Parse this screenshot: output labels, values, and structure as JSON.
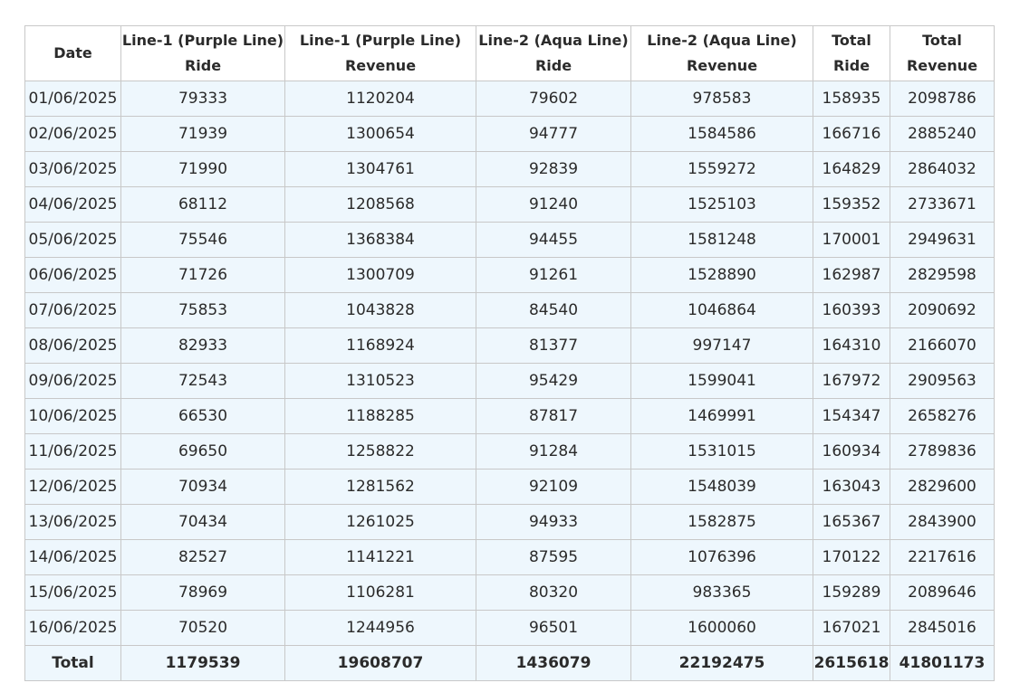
{
  "table": {
    "headers": [
      [
        "Date"
      ],
      [
        "Line-1 (Purple Line)",
        "Ride"
      ],
      [
        "Line-1 (Purple Line)",
        "Revenue"
      ],
      [
        "Line-2 (Aqua Line)",
        "Ride"
      ],
      [
        "Line-2 (Aqua Line)",
        "Revenue"
      ],
      [
        "Total",
        "Ride"
      ],
      [
        "Total",
        "Revenue"
      ]
    ],
    "rows": [
      [
        "01/06/2025",
        "79333",
        "1120204",
        "79602",
        "978583",
        "158935",
        "2098786"
      ],
      [
        "02/06/2025",
        "71939",
        "1300654",
        "94777",
        "1584586",
        "166716",
        "2885240"
      ],
      [
        "03/06/2025",
        "71990",
        "1304761",
        "92839",
        "1559272",
        "164829",
        "2864032"
      ],
      [
        "04/06/2025",
        "68112",
        "1208568",
        "91240",
        "1525103",
        "159352",
        "2733671"
      ],
      [
        "05/06/2025",
        "75546",
        "1368384",
        "94455",
        "1581248",
        "170001",
        "2949631"
      ],
      [
        "06/06/2025",
        "71726",
        "1300709",
        "91261",
        "1528890",
        "162987",
        "2829598"
      ],
      [
        "07/06/2025",
        "75853",
        "1043828",
        "84540",
        "1046864",
        "160393",
        "2090692"
      ],
      [
        "08/06/2025",
        "82933",
        "1168924",
        "81377",
        "997147",
        "164310",
        "2166070"
      ],
      [
        "09/06/2025",
        "72543",
        "1310523",
        "95429",
        "1599041",
        "167972",
        "2909563"
      ],
      [
        "10/06/2025",
        "66530",
        "1188285",
        "87817",
        "1469991",
        "154347",
        "2658276"
      ],
      [
        "11/06/2025",
        "69650",
        "1258822",
        "91284",
        "1531015",
        "160934",
        "2789836"
      ],
      [
        "12/06/2025",
        "70934",
        "1281562",
        "92109",
        "1548039",
        "163043",
        "2829600"
      ],
      [
        "13/06/2025",
        "70434",
        "1261025",
        "94933",
        "1582875",
        "165367",
        "2843900"
      ],
      [
        "14/06/2025",
        "82527",
        "1141221",
        "87595",
        "1076396",
        "170122",
        "2217616"
      ],
      [
        "15/06/2025",
        "78969",
        "1106281",
        "80320",
        "983365",
        "159289",
        "2089646"
      ],
      [
        "16/06/2025",
        "70520",
        "1244956",
        "96501",
        "1600060",
        "167021",
        "2845016"
      ]
    ],
    "totals": [
      "Total",
      "1179539",
      "19608707",
      "1436079",
      "22192475",
      "2615618",
      "41801173"
    ]
  },
  "colors": {
    "row_background": "#eef7fd",
    "header_background": "#ffffff",
    "border": "#c8c8c8",
    "text": "#2b2b2b"
  }
}
